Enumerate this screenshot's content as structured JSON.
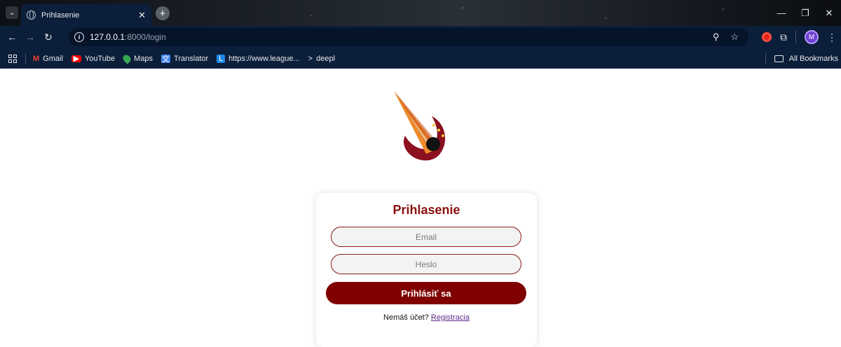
{
  "browser": {
    "tab_title": "Prihlasenie",
    "tab_close": "✕",
    "new_tab": "+",
    "url_host": "127.0.0.1",
    "url_rest": ":8000/login",
    "avatar_initial": "M",
    "window_controls": {
      "minimize": "—",
      "restore": "❐",
      "close": "✕"
    }
  },
  "bookmarks": [
    {
      "label": "Gmail",
      "icon": "gmail-icon"
    },
    {
      "label": "YouTube",
      "icon": "youtube-icon"
    },
    {
      "label": "Maps",
      "icon": "maps-icon"
    },
    {
      "label": "Translator",
      "icon": "translator-icon"
    },
    {
      "label": "https://www.league...",
      "icon": "league-icon"
    },
    {
      "label": "deepl",
      "icon": "deepl-icon"
    }
  ],
  "all_bookmarks": "All Bookmarks",
  "login": {
    "title": "Prihlasenie",
    "email_placeholder": "Email",
    "password_placeholder": "Heslo",
    "submit_label": "Prihlásiť sa",
    "no_account_text": "Nemáš účet?",
    "register_link": "Registracia"
  },
  "colors": {
    "accent": "#800000",
    "title": "#8b0f0f",
    "browser_bg": "#0b1e3a"
  }
}
